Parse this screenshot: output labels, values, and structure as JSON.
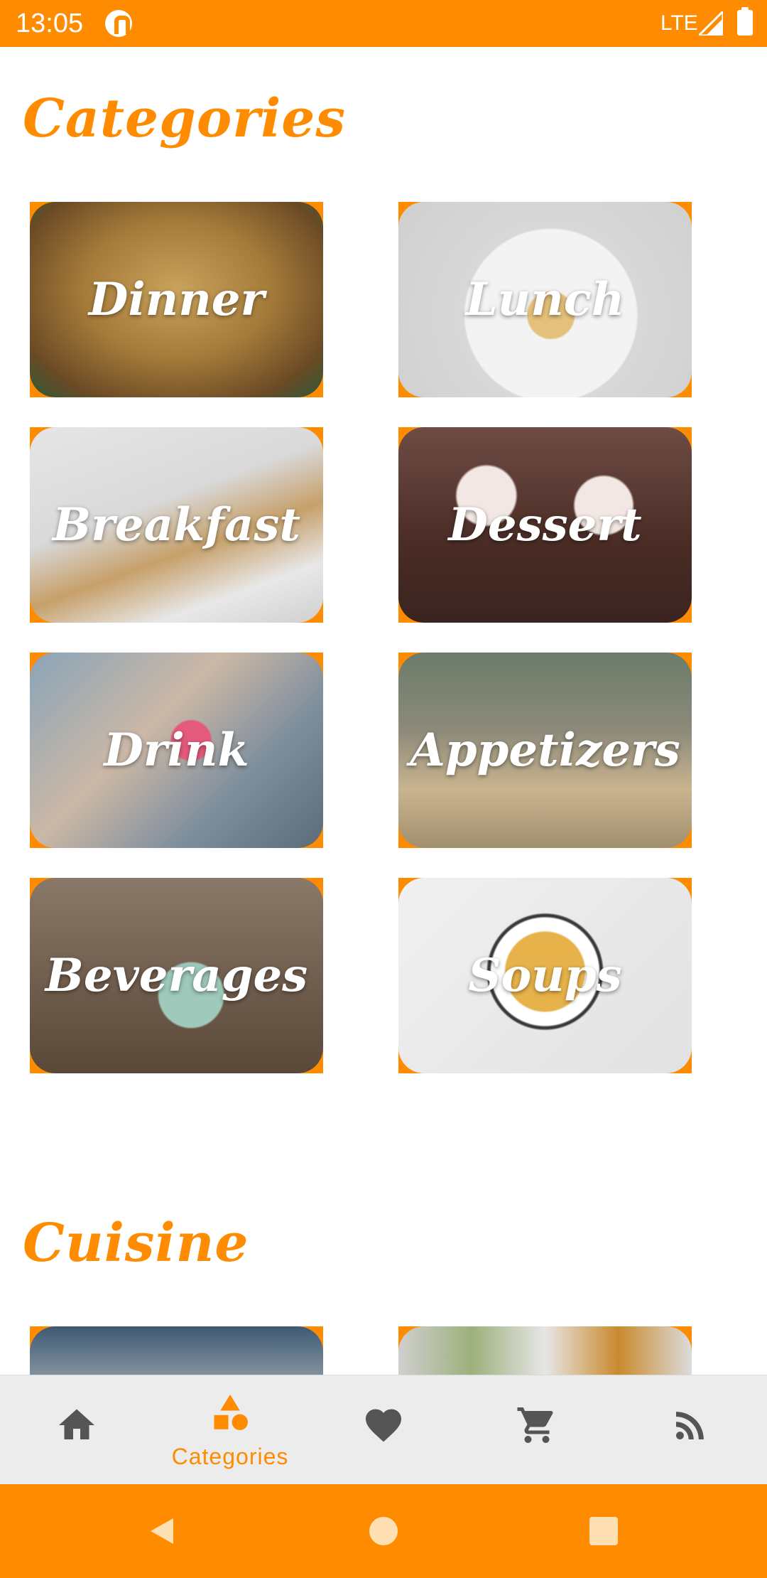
{
  "status_bar": {
    "time": "13:05",
    "network": "LTE"
  },
  "sections": {
    "categories_title": "Categories",
    "cuisine_title": "Cuisine"
  },
  "categories": [
    {
      "label": "Dinner"
    },
    {
      "label": "Lunch"
    },
    {
      "label": "Breakfast"
    },
    {
      "label": "Dessert"
    },
    {
      "label": "Drink"
    },
    {
      "label": "Appetizers"
    },
    {
      "label": "Beverages"
    },
    {
      "label": "Soups"
    }
  ],
  "bottom_nav": {
    "active_label": "Categories",
    "items": [
      {
        "icon": "home-icon"
      },
      {
        "icon": "categories-icon"
      },
      {
        "icon": "heart-icon"
      },
      {
        "icon": "cart-icon"
      },
      {
        "icon": "rss-icon"
      }
    ]
  },
  "colors": {
    "accent": "#FF8C00",
    "nav_background": "#ECECEC",
    "nav_icon": "#555555"
  }
}
